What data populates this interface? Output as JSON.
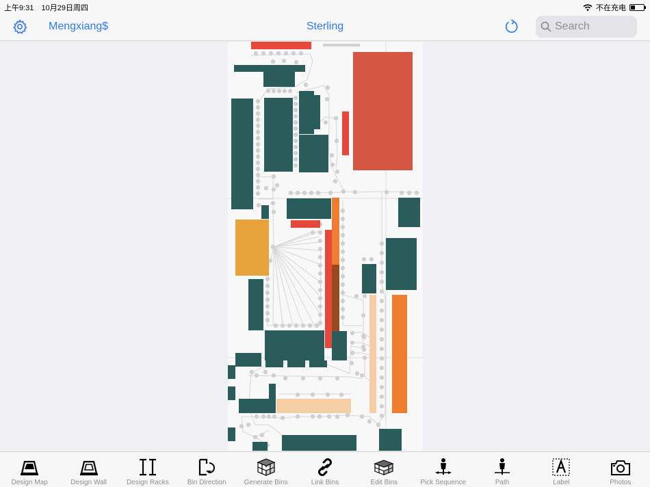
{
  "status_bar": {
    "time": "上午9:31",
    "date": "10月29日周四",
    "charging": "不在充电",
    "battery_level_percent": 30
  },
  "nav": {
    "user": "Mengxiang$",
    "title": "Sterling",
    "search_placeholder": "Search",
    "icons": [
      "gear-icon",
      "refresh-icon",
      "search-icon"
    ]
  },
  "colors": {
    "accent": "#2f7bf5",
    "rack": "#2a5c5c",
    "red_bin": "#d65644",
    "bright_red": "#e8483c",
    "orange_bin": "#ee7d30",
    "amber_bin": "#e8a23a",
    "peach_bin": "#f6cea6",
    "brown_bin": "#964a1e",
    "path_node": "#d0d0d0"
  },
  "tabs": [
    {
      "label": "Design Map",
      "icon": "design-map-icon"
    },
    {
      "label": "Design Wall",
      "icon": "design-wall-icon"
    },
    {
      "label": "Design Racks",
      "icon": "design-racks-icon"
    },
    {
      "label": "Bin Direction",
      "icon": "bin-direction-icon"
    },
    {
      "label": "Generate Bins",
      "icon": "generate-bins-icon"
    },
    {
      "label": "Link Bins",
      "icon": "link-bins-icon"
    },
    {
      "label": "Edit Bins",
      "icon": "edit-bins-icon"
    },
    {
      "label": "Pick Sequence",
      "icon": "pick-sequence-icon"
    },
    {
      "label": "Path",
      "icon": "path-icon"
    },
    {
      "label": "Label",
      "icon": "label-icon"
    },
    {
      "label": "Photos",
      "icon": "photos-icon"
    }
  ]
}
